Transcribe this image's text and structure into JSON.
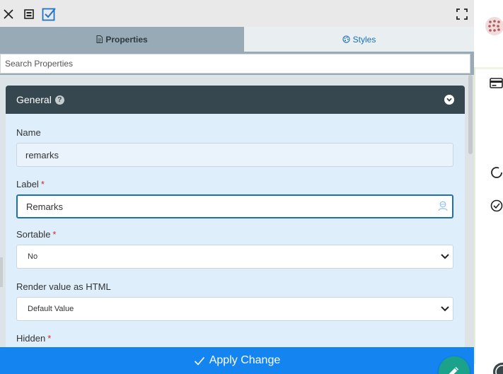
{
  "toolbar": {
    "close_icon": "close-icon",
    "panel_icon": "panel-icon",
    "check_icon": "checkbox-icon",
    "expand_icon": "fullscreen-icon"
  },
  "tabs": {
    "properties": {
      "label": "Properties",
      "icon": "document-icon"
    },
    "styles": {
      "label": "Styles",
      "icon": "palette-icon"
    }
  },
  "search": {
    "placeholder": "Search Properties"
  },
  "section": {
    "title": "General",
    "help_icon": "question-icon",
    "toggle_icon": "chevron-down-circle-icon"
  },
  "fields": {
    "name": {
      "label": "Name",
      "value": "remarks"
    },
    "label": {
      "label": "Label",
      "required_mark": "*",
      "value": "Remarks"
    },
    "sortable": {
      "label": "Sortable",
      "required_mark": "*",
      "selected": "No"
    },
    "render_html": {
      "label": "Render value as HTML",
      "selected": "Default Value"
    },
    "hidden": {
      "label": "Hidden",
      "required_mark": "*"
    }
  },
  "apply": {
    "label": "Apply Change",
    "icon": "check-icon"
  },
  "fab": {
    "icon": "pencil-icon"
  },
  "colors": {
    "header": "#37474f",
    "accent": "#1485f0",
    "active_tab": "#97aab5",
    "card_bg": "#deeefb",
    "fab": "#1aa38a",
    "required": "#d62828"
  }
}
